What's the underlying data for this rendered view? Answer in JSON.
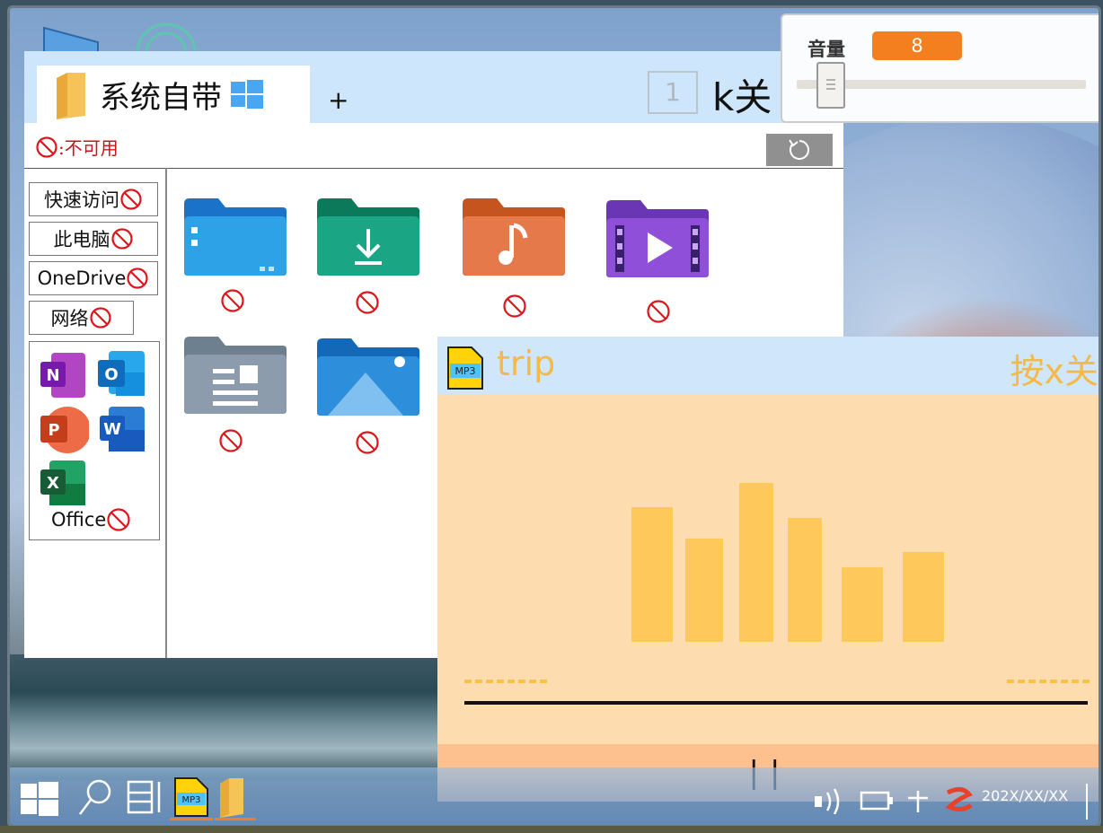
{
  "explorer": {
    "tab_label": "系统自带",
    "new_tab": "+",
    "tab_count": "1",
    "close_hint": "k关",
    "unavailable_label": ":不可用",
    "sidebar": [
      "快速访问",
      "此电脑",
      "OneDrive",
      "网络"
    ],
    "office_label": "Office"
  },
  "player": {
    "track_name": "trip",
    "close_hint": "按x关",
    "pause_label": "||",
    "eq_levels": [
      0.78,
      0.6,
      0.92,
      0.72,
      0.43,
      0.52
    ],
    "progress": 0.0
  },
  "volume": {
    "label": "音量",
    "value": "8",
    "level": 0.08
  },
  "taskbar": {
    "clock": "202X/XX/XX"
  },
  "colors": {
    "accent_orange": "#f47f1f",
    "title_blue": "#cde6fb",
    "player_bg": "#fddcaf",
    "player_text": "#f5b94a",
    "eq_bar": "#fec85b",
    "ban_red": "#e0141a"
  }
}
